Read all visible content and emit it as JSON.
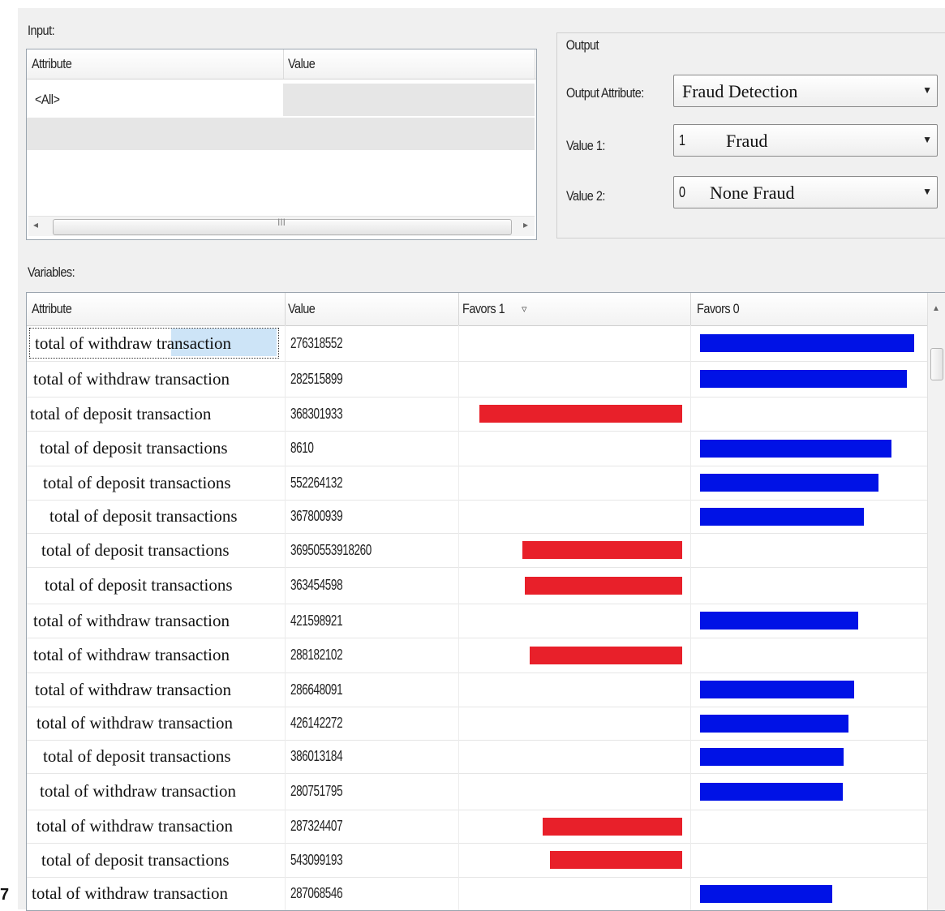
{
  "page_number": "7",
  "input": {
    "label": "Input:",
    "columns": [
      "Attribute",
      "Value"
    ],
    "rows": [
      {
        "attribute": "<All>",
        "value": ""
      }
    ],
    "scroll_grip": "III"
  },
  "output": {
    "group_label": "Output",
    "output_attribute_label": "Output Attribute:",
    "output_attribute_value": "Fraud Detection",
    "value1_label": "Value 1:",
    "value1_num": "1",
    "value1_text": "Fraud",
    "value2_label": "Value 2:",
    "value2_num": "0",
    "value2_text": "None Fraud"
  },
  "variables": {
    "label": "Variables:",
    "columns": [
      "Attribute",
      "Value",
      "Favors 1",
      "Favors 0"
    ],
    "sort_icon": "sort-filter-icon",
    "rows": [
      {
        "attribute": "total of withdraw transaction",
        "value": "276318552",
        "favors": 0,
        "score": 1.0
      },
      {
        "attribute": "total of withdraw transaction",
        "value": "282515899",
        "favors": 0,
        "score": 0.965
      },
      {
        "attribute": "total of  deposit transaction",
        "value": "368301933",
        "favors": 1,
        "score": 1.0
      },
      {
        "attribute": "total of deposit transactions",
        "value": "8610",
        "favors": 0,
        "score": 0.893
      },
      {
        "attribute": "total of deposit transactions",
        "value": "552264132",
        "favors": 0,
        "score": 0.832
      },
      {
        "attribute": "total of deposit transactions",
        "value": "367800939",
        "favors": 0,
        "score": 0.767
      },
      {
        "attribute": "total of deposit transactions",
        "value": "36950553918260",
        "favors": 1,
        "score": 0.788
      },
      {
        "attribute": "total of deposit transactions",
        "value": "363454598",
        "favors": 1,
        "score": 0.776
      },
      {
        "attribute": "total of withdraw transaction",
        "value": "421598921",
        "favors": 0,
        "score": 0.737
      },
      {
        "attribute": "total of withdraw transaction",
        "value": "288182102",
        "favors": 1,
        "score": 0.752
      },
      {
        "attribute": "total of withdraw transaction",
        "value": "286648091",
        "favors": 0,
        "score": 0.721
      },
      {
        "attribute": "total of withdraw transaction",
        "value": "426142272",
        "favors": 0,
        "score": 0.695
      },
      {
        "attribute": "total of deposit transactions",
        "value": "386013184",
        "favors": 0,
        "score": 0.672
      },
      {
        "attribute": "total of withdraw transaction",
        "value": "280751795",
        "favors": 0,
        "score": 0.668
      },
      {
        "attribute": "total of withdraw transaction",
        "value": "287324407",
        "favors": 1,
        "score": 0.688
      },
      {
        "attribute": "total of deposit transactions",
        "value": "543099193",
        "favors": 1,
        "score": 0.652
      },
      {
        "attribute": "total of withdraw transaction",
        "value": "287068546",
        "favors": 0,
        "score": 0.616
      }
    ]
  },
  "colors": {
    "favors1": "#e8202a",
    "favors0": "#0012e6",
    "selection": "#cde4f7"
  }
}
